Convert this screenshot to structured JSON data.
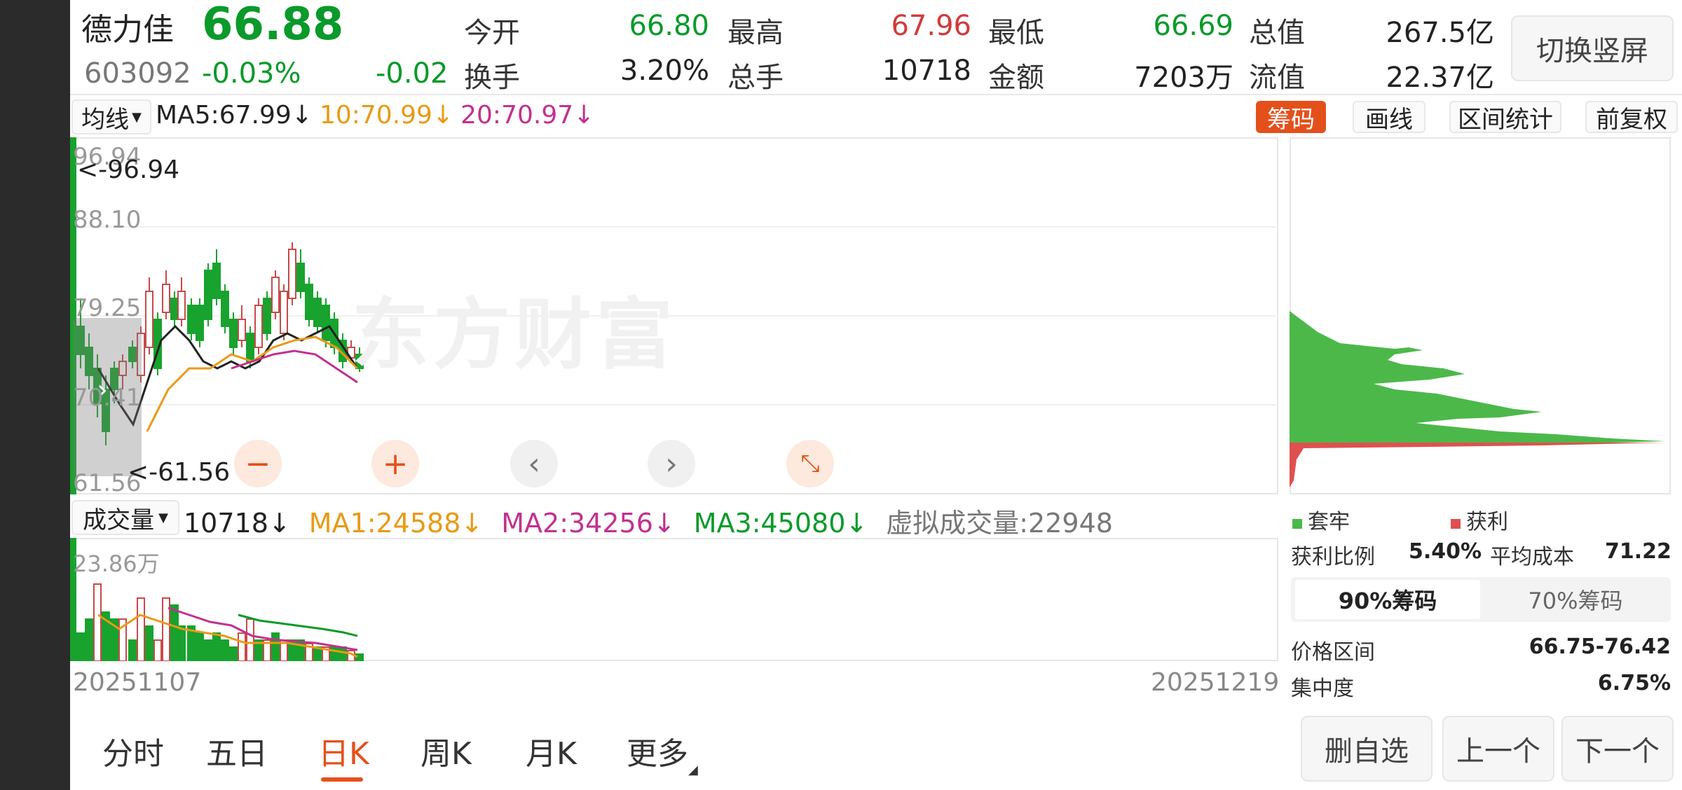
{
  "header": {
    "name": "德力佳",
    "price": "66.88",
    "code": "603092",
    "change_pct": "-0.03%",
    "change": "-0.02",
    "stats": [
      {
        "label": "今开",
        "value": "66.80"
      },
      {
        "label": "最高",
        "value": "67.96"
      },
      {
        "label": "最低",
        "value": "66.69"
      },
      {
        "label": "总值",
        "value": "267.5亿"
      },
      {
        "label": "换手",
        "value": "3.20%"
      },
      {
        "label": "总手",
        "value": "10718"
      },
      {
        "label": "金额",
        "value": "7203万"
      },
      {
        "label": "流值",
        "value": "22.37亿"
      }
    ],
    "switch_label": "切换竖屏"
  },
  "ma_bar": {
    "select": "均线",
    "ma5": "MA5:67.99",
    "ma10": "10:70.99",
    "ma20": "20:70.97",
    "arrow": "↓",
    "chips": {
      "active": "筹码",
      "draw": "画线",
      "range": "区间统计",
      "adjust": "前复权"
    }
  },
  "price_chart": {
    "y_labels": [
      "96.94",
      "88.10",
      "79.25",
      "70.41",
      "61.56"
    ],
    "max_label": "<-96.94",
    "min_label": "<-61.56",
    "watermark": "东方财富"
  },
  "volume_bar": {
    "select": "成交量",
    "vol": "10718",
    "ma1": "MA1:24588",
    "ma2": "MA2:34256",
    "ma3": "MA3:45080",
    "virtual": "虚拟成交量:22948",
    "arrow": "↓",
    "y_label": "23.86万"
  },
  "date_axis": {
    "start": "20251107",
    "end": "20251219"
  },
  "chips_panel": {
    "legend_trapped": "套牢",
    "legend_profit": "获利",
    "profit_ratio_label": "获利比例",
    "profit_ratio_value": "5.40%",
    "avg_cost_label": "平均成本",
    "avg_cost_value": "71.22",
    "tab_90": "90%筹码",
    "tab_70": "70%筹码",
    "range_label": "价格区间",
    "range_value": "66.75-76.42",
    "concentration_label": "集中度",
    "concentration_value": "6.75%"
  },
  "bottom_tabs": [
    "分时",
    "五日",
    "日K",
    "周K",
    "月K",
    "更多"
  ],
  "active_tab": "日K",
  "bottom_buttons": {
    "delete": "删自选",
    "prev": "上一个",
    "next": "下一个"
  },
  "colors": {
    "up": "#d13b3b",
    "down": "#0a9a2a",
    "accent": "#e4501b",
    "ma10": "#e89a16",
    "ma20": "#c2318e"
  }
}
